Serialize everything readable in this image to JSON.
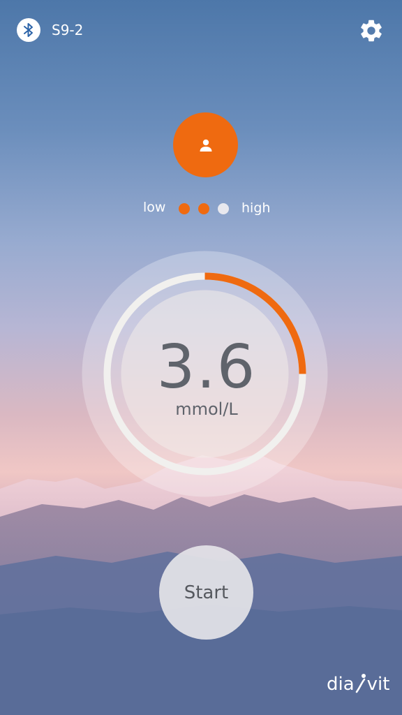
{
  "header": {
    "bluetooth_icon": "bluetooth-icon",
    "device_name": "S9-2",
    "settings_icon": "gear-icon"
  },
  "profile": {
    "icon": "person-icon",
    "color": "#ef6a10"
  },
  "level": {
    "low_label": "low",
    "high_label": "high",
    "active_dots": 2,
    "total_dots": 3
  },
  "reading": {
    "value": "3.6",
    "unit": "mmol/L",
    "gauge_fraction": 0.25,
    "gauge_color": "#ef6a10"
  },
  "start_label": "Start",
  "brand": {
    "text_left": "dia",
    "text_right": "vit"
  }
}
